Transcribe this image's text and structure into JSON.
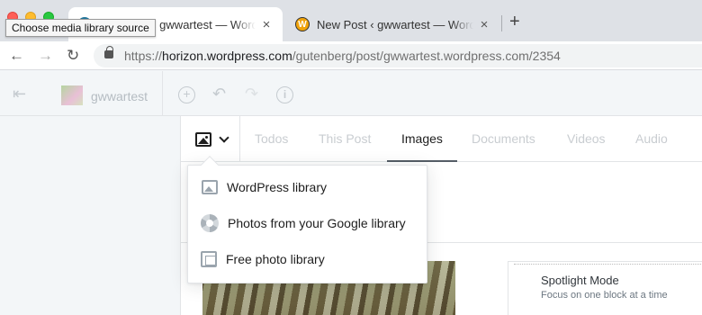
{
  "browser": {
    "tooltip": "Choose media library source",
    "tabs": [
      {
        "title": "New Post ‹ gwwartest — WordPress",
        "active": true,
        "close": "×"
      },
      {
        "title": "New Post ‹ gwwartest — WordPress",
        "active": false,
        "close": "×"
      }
    ],
    "new_tab": "+",
    "url": {
      "scheme": "https://",
      "host": "horizon.wordpress.com",
      "path": "/gutenberg/post/gwwartest.wordpress.com/2354"
    }
  },
  "editor_header": {
    "site_name": "gwwartest"
  },
  "modal": {
    "tabs": [
      {
        "label": "Todos",
        "active": false
      },
      {
        "label": "This Post",
        "active": false
      },
      {
        "label": "Images",
        "active": true
      },
      {
        "label": "Documents",
        "active": false
      },
      {
        "label": "Videos",
        "active": false
      },
      {
        "label": "Audio",
        "active": false
      }
    ]
  },
  "source_dropdown": {
    "items": [
      {
        "label": "WordPress library",
        "icon": "image-icon"
      },
      {
        "label": "Photos from your Google library",
        "icon": "google-photos-icon"
      },
      {
        "label": "Free photo library",
        "icon": "photo-gallery-icon"
      }
    ]
  },
  "spotlight": {
    "title": "Spotlight Mode",
    "description": "Focus on one block at a time"
  }
}
